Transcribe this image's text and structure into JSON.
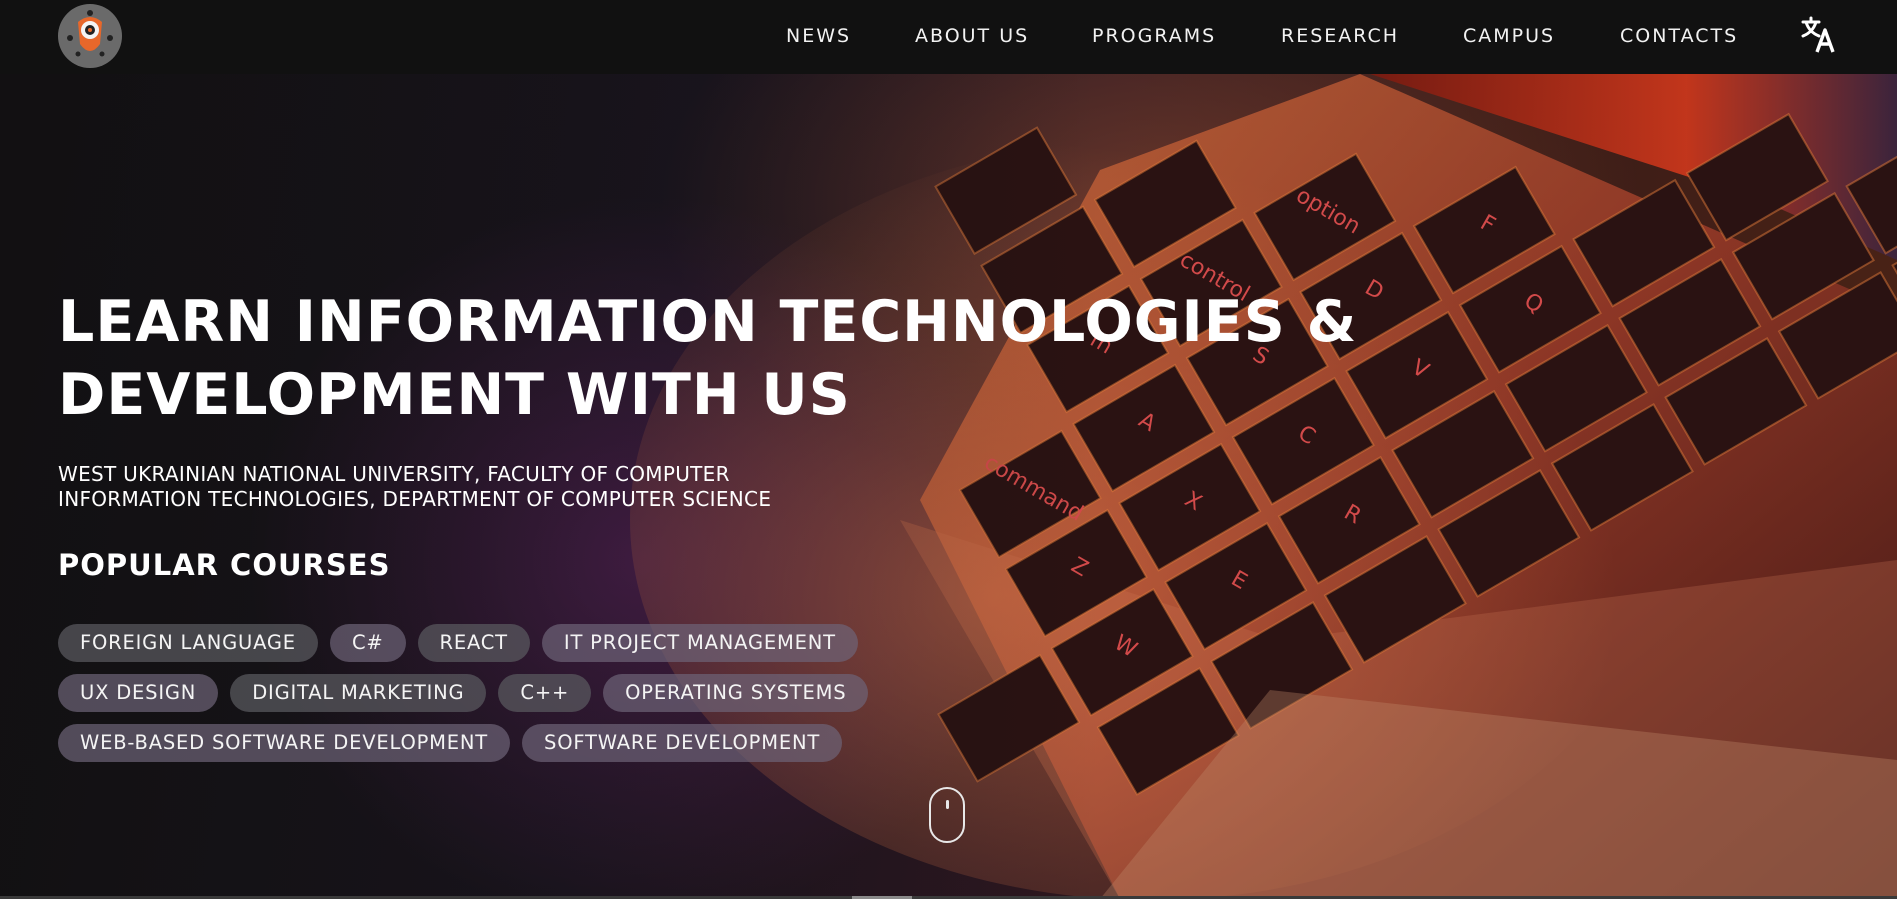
{
  "colors": {
    "background": "#111111",
    "chip": "#5a5a60",
    "accent_orange": "#e8672a",
    "text": "#ffffff"
  },
  "logo": {
    "icon": "robot-eye-logo-icon"
  },
  "nav": {
    "items": [
      {
        "label": "NEWS"
      },
      {
        "label": "ABOUT US"
      },
      {
        "label": "PROGRAMS"
      },
      {
        "label": "RESEARCH"
      },
      {
        "label": "CAMPUS"
      },
      {
        "label": "CONTACTS"
      }
    ],
    "translate_icon": "translate-icon"
  },
  "hero": {
    "title_line1": "LEARN INFORMATION TECHNOLOGIES &",
    "title_line2": "DEVELOPMENT WITH US",
    "subtitle_line1": "WEST UKRAINIAN NATIONAL UNIVERSITY, FACULTY OF COMPUTER",
    "subtitle_line2": "INFORMATION TECHNOLOGIES, DEPARTMENT OF COMPUTER SCIENCE",
    "courses_heading": "POPULAR COURSES"
  },
  "courses": {
    "row1": [
      "FOREIGN LANGUAGE",
      "C#",
      "REACT",
      "IT PROJECT MANAGEMENT"
    ],
    "row2": [
      "UX DESIGN",
      "DIGITAL MARKETING",
      "C++",
      "OPERATING SYSTEMS"
    ],
    "row3": [
      "WEB-BASED SOFTWARE DEVELOPMENT",
      "SOFTWARE DEVELOPMENT"
    ]
  },
  "background_image": {
    "keyboard_keys": [
      "fn",
      "control",
      "option",
      "command",
      "A",
      "S",
      "D",
      "F",
      "Z",
      "X",
      "C",
      "V",
      "Q",
      "W",
      "E",
      "R"
    ]
  },
  "scroll_indicator": {
    "icon": "mouse-scroll-icon"
  }
}
